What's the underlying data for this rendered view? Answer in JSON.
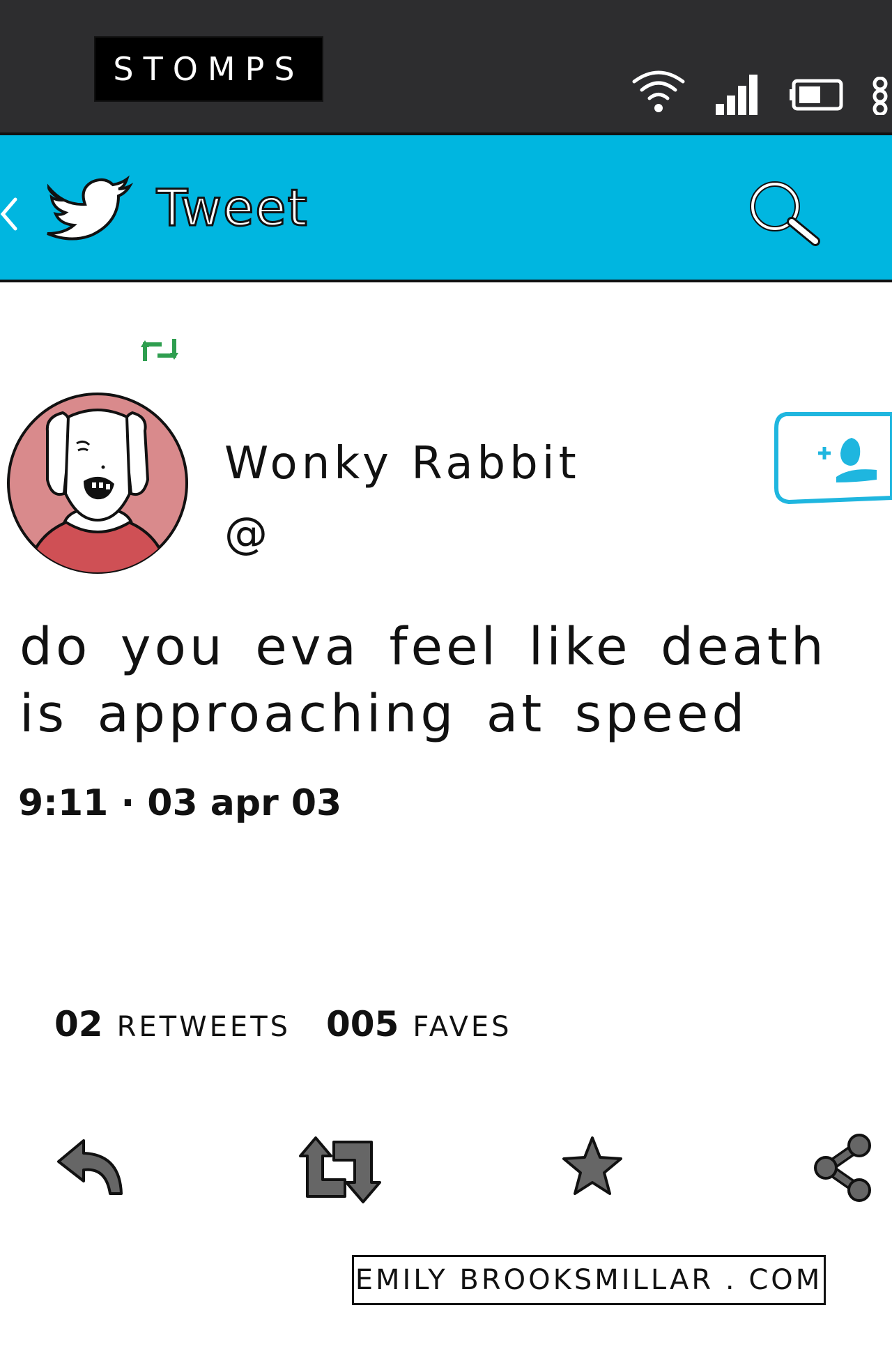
{
  "status_bar": {
    "carrier": "STOMPS"
  },
  "header": {
    "title": "Tweet"
  },
  "tweet": {
    "user_name": "Wonky Rabbit",
    "handle": "@",
    "text": "do you eva feel like death is approaching at speed",
    "timestamp": "9:11 · 03 apr 03",
    "retweets": {
      "count": "02",
      "label": "RETWEETS"
    },
    "faves": {
      "count": "005",
      "label": "FAVES"
    }
  },
  "footer": {
    "credit": "EMILY BROOKSMILLAR . COM"
  },
  "colors": {
    "header_blue": "#00b6e0",
    "status_bar": "#2d2d2f",
    "retweet_green": "#2e9e4f",
    "avatar_pink": "#d98a8c",
    "action_gray": "#666666"
  },
  "icons": [
    "wifi-icon",
    "signal-icon",
    "battery-icon",
    "menu-icon",
    "back-icon",
    "twitter-bird-icon",
    "search-icon",
    "retweet-icon",
    "follow-icon",
    "reply-icon",
    "favorite-icon",
    "share-icon"
  ]
}
